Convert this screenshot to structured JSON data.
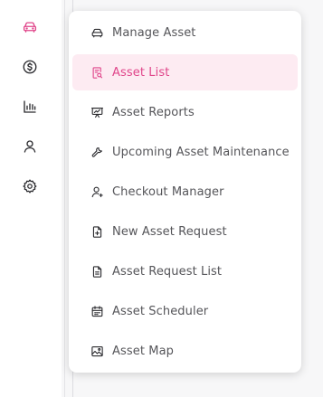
{
  "rail": {
    "items": [
      {
        "icon": "car-icon",
        "active": true
      },
      {
        "icon": "dollar-circle-icon",
        "active": false
      },
      {
        "icon": "bar-chart-icon",
        "active": false
      },
      {
        "icon": "user-icon",
        "active": false
      },
      {
        "icon": "gear-icon",
        "active": false
      }
    ]
  },
  "menu": {
    "items": [
      {
        "label": "Manage Asset",
        "icon": "car-icon"
      },
      {
        "label": "Asset List",
        "icon": "list-search-icon",
        "active": true
      },
      {
        "label": "Asset Reports",
        "icon": "presentation-chart-icon"
      },
      {
        "label": "Upcoming Asset Maintenance",
        "icon": "wrench-icon"
      },
      {
        "label": "Checkout Manager",
        "icon": "user-add-icon"
      },
      {
        "label": "New Asset Request",
        "icon": "file-plus-icon"
      },
      {
        "label": "Asset Request List",
        "icon": "file-text-icon"
      },
      {
        "label": "Asset Scheduler",
        "icon": "calendar-icon"
      },
      {
        "label": "Asset Map",
        "icon": "image-map-icon"
      }
    ]
  },
  "colors": {
    "accent": "#e0458a",
    "active_bg": "#fdebf2",
    "text": "#555559",
    "icon": "#2b2b2f"
  }
}
